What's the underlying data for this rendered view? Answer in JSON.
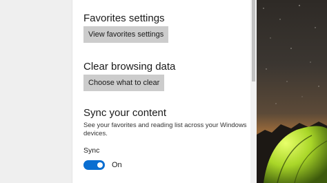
{
  "favorites": {
    "heading": "Favorites settings",
    "button_label": "View favorites settings"
  },
  "browsing": {
    "heading": "Clear browsing data",
    "button_label": "Choose what to clear"
  },
  "sync": {
    "heading": "Sync your content",
    "description": "See your favorites and reading list across your Windows devices.",
    "label": "Sync",
    "state": "On",
    "enabled": true
  },
  "colors": {
    "accent": "#0a6ed1",
    "button_bg": "#cccccc"
  }
}
